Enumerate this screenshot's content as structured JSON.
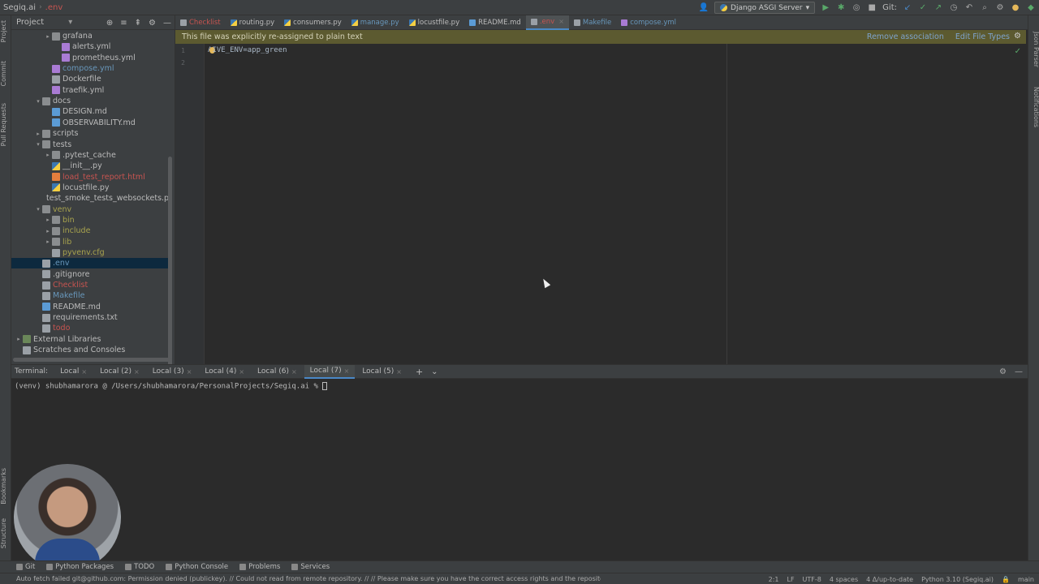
{
  "navbar": {
    "project": "Segiq.ai",
    "file": ".env",
    "run_config": "Django ASGI Server",
    "git_label": "Git:"
  },
  "left_strip": [
    "Project",
    "Commit",
    "Pull Requests",
    "Bookmarks",
    "Structure"
  ],
  "right_strip": [
    "Json Parser",
    "Notifications"
  ],
  "project_panel": {
    "title": "Project",
    "tree": [
      {
        "label": "grafana",
        "type": "folder",
        "depth": 3,
        "arrow": "▸",
        "color": "def"
      },
      {
        "label": "alerts.yml",
        "type": "yml",
        "depth": 4,
        "color": "def"
      },
      {
        "label": "prometheus.yml",
        "type": "yml",
        "depth": 4,
        "color": "def"
      },
      {
        "label": "compose.yml",
        "type": "yml",
        "depth": 3,
        "color": "blue"
      },
      {
        "label": "Dockerfile",
        "type": "file",
        "depth": 3,
        "color": "def"
      },
      {
        "label": "traefik.yml",
        "type": "yml",
        "depth": 3,
        "color": "def"
      },
      {
        "label": "docs",
        "type": "folder",
        "depth": 2,
        "arrow": "▾",
        "color": "def"
      },
      {
        "label": "DESIGN.md",
        "type": "md",
        "depth": 3,
        "color": "def"
      },
      {
        "label": "OBSERVABILITY.md",
        "type": "md",
        "depth": 3,
        "color": "def"
      },
      {
        "label": "scripts",
        "type": "folder",
        "depth": 2,
        "arrow": "▸",
        "color": "def"
      },
      {
        "label": "tests",
        "type": "folder",
        "depth": 2,
        "arrow": "▾",
        "color": "def"
      },
      {
        "label": ".pytest_cache",
        "type": "folder",
        "depth": 3,
        "arrow": "▸",
        "color": "def"
      },
      {
        "label": "__init__.py",
        "type": "py",
        "depth": 3,
        "color": "def"
      },
      {
        "label": "load_test_report.html",
        "type": "html",
        "depth": 3,
        "color": "red"
      },
      {
        "label": "locustfile.py",
        "type": "py",
        "depth": 3,
        "color": "def"
      },
      {
        "label": "test_smoke_tests_websockets.p",
        "type": "py",
        "depth": 3,
        "color": "def"
      },
      {
        "label": "venv",
        "type": "folder",
        "depth": 2,
        "arrow": "▾",
        "color": "olive"
      },
      {
        "label": "bin",
        "type": "folder",
        "depth": 3,
        "arrow": "▸",
        "color": "olive"
      },
      {
        "label": "include",
        "type": "folder",
        "depth": 3,
        "arrow": "▸",
        "color": "olive"
      },
      {
        "label": "lib",
        "type": "folder",
        "depth": 3,
        "arrow": "▸",
        "color": "olive"
      },
      {
        "label": "pyvenv.cfg",
        "type": "file",
        "depth": 3,
        "color": "olive"
      },
      {
        "label": ".env",
        "type": "file",
        "depth": 2,
        "color": "env",
        "selected": true
      },
      {
        "label": ".gitignore",
        "type": "file",
        "depth": 2,
        "color": "def"
      },
      {
        "label": "Checklist",
        "type": "file",
        "depth": 2,
        "color": "red"
      },
      {
        "label": "Makefile",
        "type": "file",
        "depth": 2,
        "color": "blue"
      },
      {
        "label": "README.md",
        "type": "md",
        "depth": 2,
        "color": "def"
      },
      {
        "label": "requirements.txt",
        "type": "file",
        "depth": 2,
        "color": "def"
      },
      {
        "label": "todo",
        "type": "file",
        "depth": 2,
        "color": "red"
      },
      {
        "label": "External Libraries",
        "type": "lib",
        "depth": 0,
        "arrow": "▸",
        "color": "def"
      },
      {
        "label": "Scratches and Consoles",
        "type": "file",
        "depth": 0,
        "color": "def"
      }
    ]
  },
  "tabs": [
    {
      "label": "Checklist",
      "color": "#c75450",
      "icon": "#9aa0a6"
    },
    {
      "label": "routing.py",
      "color": "#bbbbbb",
      "icon": "py"
    },
    {
      "label": "consumers.py",
      "color": "#bbbbbb",
      "icon": "py"
    },
    {
      "label": "manage.py",
      "color": "#6897bb",
      "icon": "py"
    },
    {
      "label": "locustfile.py",
      "color": "#bbbbbb",
      "icon": "py"
    },
    {
      "label": "README.md",
      "color": "#bbbbbb",
      "icon": "#5b9bd5"
    },
    {
      "label": ".env",
      "color": "#c75450",
      "icon": "#9aa0a6",
      "active": true
    },
    {
      "label": "Makefile",
      "color": "#6897bb",
      "icon": "#9aa0a6"
    },
    {
      "label": "compose.yml",
      "color": "#6897bb",
      "icon": "#a97bd4"
    }
  ],
  "banner": {
    "text": "This file was explicitly re-assigned to plain text",
    "remove": "Remove association",
    "edit": "Edit File Types"
  },
  "editor": {
    "lines": [
      "1",
      "2"
    ],
    "code_prefix": "A",
    "code_rest": "IVE_ENV=app_green"
  },
  "terminal": {
    "label": "Terminal:",
    "tabs": [
      "Local",
      "Local (2)",
      "Local (3)",
      "Local (4)",
      "Local (6)",
      "Local (7)",
      "Local (5)"
    ],
    "active_index": 5,
    "prompt": "(venv) shubhamarora @ /Users/shubhamarora/PersonalProjects/Segiq.ai % "
  },
  "bottom_tools": [
    "Git",
    "Python Packages",
    "TODO",
    "Python Console",
    "Problems",
    "Services"
  ],
  "status": {
    "message": "Auto fetch failed git@github.com: Permission denied (publickey). // Could not read from remote repository. // // Please make sure you have the correct access rights and the repository exi... (a minute ago)",
    "position": "2:1",
    "line_sep": "LF",
    "encoding": "UTF-8",
    "indent": "4 spaces",
    "vcs": "4 Δ/up-to-date",
    "interpreter": "Python 3.10 (Segiq.ai)",
    "branch": "main"
  },
  "colors": {
    "def": "#bbbbbb",
    "blue": "#6897bb",
    "red": "#c75450",
    "olive": "#a8a34e",
    "env": "#6897bb"
  }
}
